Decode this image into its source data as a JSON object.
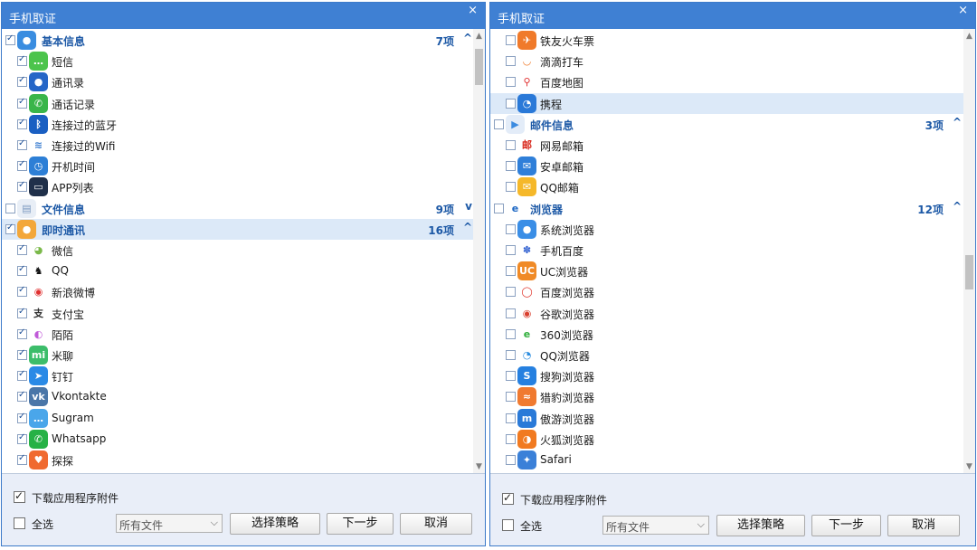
{
  "left": {
    "title": "手机取证",
    "close": "×",
    "rows": [
      {
        "type": "cat",
        "checked": true,
        "icon": "person-icon",
        "color": "#3a8de0",
        "glyph": "●",
        "label": "基本信息",
        "count": "7项",
        "chev": "^"
      },
      {
        "type": "item",
        "checked": true,
        "icon": "sms-icon",
        "color": "#4cc44c",
        "glyph": "…",
        "label": "短信"
      },
      {
        "type": "item",
        "checked": true,
        "icon": "contacts-icon",
        "color": "#2566c7",
        "glyph": "●",
        "label": "通讯录"
      },
      {
        "type": "item",
        "checked": true,
        "icon": "phone-icon",
        "color": "#39b54a",
        "glyph": "✆",
        "label": "通话记录"
      },
      {
        "type": "item",
        "checked": true,
        "icon": "bluetooth-icon",
        "color": "#1a5fc2",
        "glyph": "ᛒ",
        "label": "连接过的蓝牙"
      },
      {
        "type": "item",
        "checked": true,
        "icon": "wifi-icon",
        "color": "#ffffff",
        "glyph": "≋",
        "fg": "#3a7dd0",
        "label": "连接过的Wifi"
      },
      {
        "type": "item",
        "checked": true,
        "icon": "clock-icon",
        "color": "#2d7fd6",
        "glyph": "◷",
        "label": "开机时间"
      },
      {
        "type": "item",
        "checked": true,
        "icon": "monitor-icon",
        "color": "#20304a",
        "glyph": "▭",
        "label": "APP列表"
      },
      {
        "type": "cat",
        "checked": false,
        "icon": "folder-icon",
        "color": "#e8eef6",
        "glyph": "▤",
        "fg": "#7a98bf",
        "label": "文件信息",
        "count": "9项",
        "chev": "v"
      },
      {
        "type": "cat",
        "checked": true,
        "sel": true,
        "icon": "chat-bubbles-icon",
        "color": "#f3a73a",
        "glyph": "●",
        "label": "即时通讯",
        "count": "16项",
        "chev": "^"
      },
      {
        "type": "item",
        "checked": true,
        "icon": "wechat-icon",
        "color": "#ffffff",
        "glyph": "◕",
        "fg": "#7bb94a",
        "label": "微信"
      },
      {
        "type": "item",
        "checked": true,
        "icon": "qq-icon",
        "color": "#ffffff",
        "glyph": "♞",
        "fg": "#111111",
        "label": "QQ"
      },
      {
        "type": "item",
        "checked": true,
        "icon": "weibo-icon",
        "color": "#ffffff",
        "glyph": "◉",
        "fg": "#e03030",
        "label": "新浪微博"
      },
      {
        "type": "item",
        "checked": true,
        "icon": "alipay-icon",
        "color": "#ffffff",
        "glyph": "支",
        "fg": "#333333",
        "label": "支付宝"
      },
      {
        "type": "item",
        "checked": true,
        "icon": "momo-icon",
        "color": "#ffffff",
        "glyph": "◐",
        "fg": "#c05ad8",
        "label": "陌陌"
      },
      {
        "type": "item",
        "checked": true,
        "icon": "miliao-icon",
        "color": "#3cbd6a",
        "glyph": "mi",
        "label": "米聊"
      },
      {
        "type": "item",
        "checked": true,
        "icon": "dingtalk-icon",
        "color": "#2a8ae6",
        "glyph": "➤",
        "label": "钉钉"
      },
      {
        "type": "item",
        "checked": true,
        "icon": "vk-icon",
        "color": "#4a76a8",
        "glyph": "vk",
        "label": "Vkontakte"
      },
      {
        "type": "item",
        "checked": true,
        "icon": "sugram-icon",
        "color": "#4aa6ea",
        "glyph": "…",
        "label": "Sugram"
      },
      {
        "type": "item",
        "checked": true,
        "icon": "whatsapp-icon",
        "color": "#26b146",
        "glyph": "✆",
        "label": "Whatsapp"
      },
      {
        "type": "item",
        "checked": true,
        "icon": "tantan-icon",
        "color": "#f06a30",
        "glyph": "♥",
        "label": "探探"
      }
    ],
    "download_label": "下载应用程序附件",
    "download_checked": true,
    "select_all_label": "全选",
    "select_all_checked": false,
    "file_filter": "所有文件",
    "btn_strategy": "选择策略",
    "btn_next": "下一步",
    "btn_cancel": "取消"
  },
  "right": {
    "title": "手机取证",
    "close": "×",
    "rows": [
      {
        "type": "item",
        "checked": false,
        "icon": "train-ticket-icon",
        "color": "#f07a2a",
        "glyph": "✈",
        "label": "铁友火车票"
      },
      {
        "type": "item",
        "checked": false,
        "icon": "didi-icon",
        "color": "#ffffff",
        "glyph": "◡",
        "fg": "#f07a2a",
        "label": "滴滴打车"
      },
      {
        "type": "item",
        "checked": false,
        "icon": "map-pin-icon",
        "color": "#ffffff",
        "glyph": "⚲",
        "fg": "#e03030",
        "label": "百度地图"
      },
      {
        "type": "item",
        "checked": false,
        "sel": true,
        "icon": "ctrip-icon",
        "color": "#2a79d8",
        "glyph": "◔",
        "label": "携程"
      },
      {
        "type": "cat",
        "checked": false,
        "icon": "mail-doc-icon",
        "color": "#e3ecf8",
        "glyph": "▶",
        "fg": "#3c8be0",
        "label": "邮件信息",
        "count": "3项",
        "chev": "^"
      },
      {
        "type": "item",
        "checked": false,
        "icon": "netease-mail-icon",
        "color": "#ffffff",
        "glyph": "邮",
        "fg": "#d8281c",
        "label": "网易邮箱"
      },
      {
        "type": "item",
        "checked": false,
        "icon": "android-mail-icon",
        "color": "#2f7fd9",
        "glyph": "✉",
        "label": "安卓邮箱"
      },
      {
        "type": "item",
        "checked": false,
        "icon": "qq-mail-icon",
        "color": "#f5b82a",
        "glyph": "✉",
        "label": "QQ邮箱"
      },
      {
        "type": "cat",
        "checked": false,
        "icon": "ie-browser-icon",
        "color": "#ffffff",
        "glyph": "e",
        "fg": "#1c67c4",
        "label": "浏览器",
        "count": "12项",
        "chev": "^"
      },
      {
        "type": "item",
        "checked": false,
        "icon": "system-browser-icon",
        "color": "#3a8ee6",
        "glyph": "●",
        "label": "系统浏览器"
      },
      {
        "type": "item",
        "checked": false,
        "icon": "baidu-paw-icon",
        "color": "#ffffff",
        "glyph": "✽",
        "fg": "#2f5fd0",
        "label": "手机百度"
      },
      {
        "type": "item",
        "checked": false,
        "icon": "uc-browser-icon",
        "color": "#f08a26",
        "glyph": "UC",
        "label": "UC浏览器"
      },
      {
        "type": "item",
        "checked": false,
        "icon": "baidu-browser-icon",
        "color": "#ffffff",
        "glyph": "◯",
        "fg": "#e0342a",
        "label": "百度浏览器"
      },
      {
        "type": "item",
        "checked": false,
        "icon": "chrome-icon",
        "color": "#ffffff",
        "glyph": "◉",
        "fg": "#d9402f",
        "label": "谷歌浏览器"
      },
      {
        "type": "item",
        "checked": false,
        "icon": "360-browser-icon",
        "color": "#ffffff",
        "glyph": "e",
        "fg": "#2fae3a",
        "label": "360浏览器"
      },
      {
        "type": "item",
        "checked": false,
        "icon": "qq-browser-icon",
        "color": "#ffffff",
        "glyph": "◔",
        "fg": "#2b8de0",
        "label": "QQ浏览器"
      },
      {
        "type": "item",
        "checked": false,
        "icon": "sogou-browser-icon",
        "color": "#2680e0",
        "glyph": "S",
        "label": "搜狗浏览器"
      },
      {
        "type": "item",
        "checked": false,
        "icon": "liebao-browser-icon",
        "color": "#f07a30",
        "glyph": "≈",
        "label": "猎豹浏览器"
      },
      {
        "type": "item",
        "checked": false,
        "icon": "maxthon-browser-icon",
        "color": "#2a7ad8",
        "glyph": "m",
        "label": "傲游浏览器"
      },
      {
        "type": "item",
        "checked": false,
        "icon": "firefox-icon",
        "color": "#f17a20",
        "glyph": "◑",
        "label": "火狐浏览器"
      },
      {
        "type": "item",
        "checked": false,
        "icon": "safari-compass-icon",
        "color": "#3a80d8",
        "glyph": "✦",
        "label": "Safari"
      }
    ],
    "download_label": "下载应用程序附件",
    "download_checked": true,
    "select_all_label": "全选",
    "select_all_checked": false,
    "file_filter": "所有文件",
    "btn_strategy": "选择策略",
    "btn_next": "下一步",
    "btn_cancel": "取消"
  }
}
